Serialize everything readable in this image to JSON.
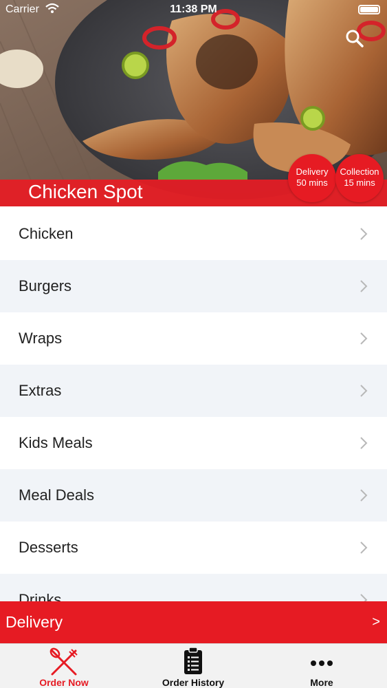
{
  "status_bar": {
    "carrier": "Carrier",
    "time": "11:38 PM"
  },
  "header": {
    "restaurant_name": "Chicken Spot",
    "delivery_badge": {
      "line1": "Delivery",
      "line2": "50 mins"
    },
    "collection_badge": {
      "line1": "Collection",
      "line2": "15 mins"
    }
  },
  "categories": [
    {
      "label": "Chicken"
    },
    {
      "label": "Burgers"
    },
    {
      "label": "Wraps"
    },
    {
      "label": "Extras"
    },
    {
      "label": "Kids Meals"
    },
    {
      "label": "Meal Deals"
    },
    {
      "label": "Desserts"
    },
    {
      "label": "Drinks"
    }
  ],
  "delivery_bar": {
    "label": "Delivery",
    "arrow": ">"
  },
  "tab_bar": {
    "order_now": "Order Now",
    "order_history": "Order History",
    "more": "More"
  },
  "colors": {
    "accent": "#e61b23",
    "row_alt": "#f1f4f8"
  }
}
